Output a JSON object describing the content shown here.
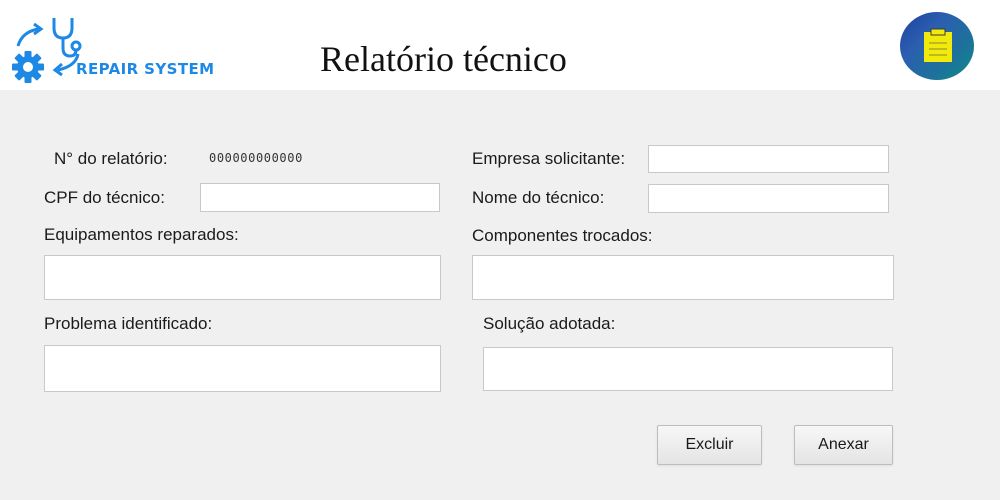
{
  "header": {
    "logo_text": "REPAIR SYSTEM",
    "title": "Relatório técnico",
    "clipboard_icon": "clipboard-icon"
  },
  "form": {
    "report_number_label": "N° do relatório:",
    "report_number_value": "000000000000",
    "company_label": "Empresa solicitante:",
    "company_value": "",
    "cpf_label": "CPF do técnico:",
    "cpf_value": "",
    "tech_name_label": "Nome do técnico:",
    "tech_name_value": "",
    "equipment_label": "Equipamentos reparados:",
    "equipment_value": "",
    "components_label": "Componentes trocados:",
    "components_value": "",
    "problem_label": "Problema identificado:",
    "problem_value": "",
    "solution_label": "Solução adotada:",
    "solution_value": ""
  },
  "actions": {
    "delete_label": "Excluir",
    "attach_label": "Anexar"
  },
  "colors": {
    "brand_blue": "#1e88e5",
    "clipboard_yellow": "#f2ea0d"
  }
}
